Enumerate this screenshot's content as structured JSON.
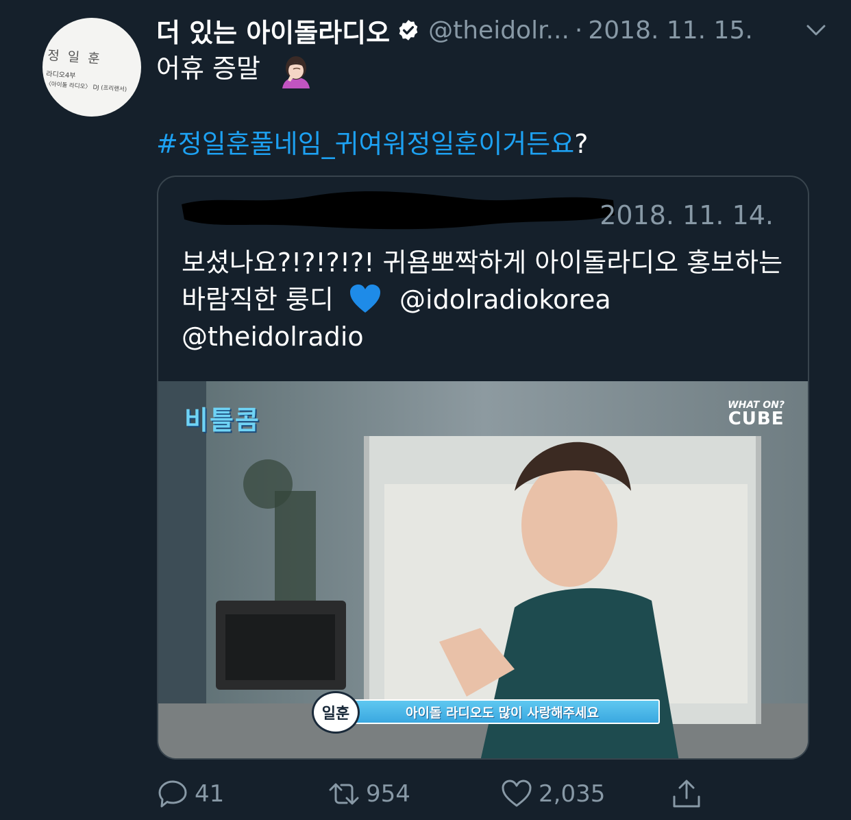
{
  "profile": {
    "avatar_name": "정 일 훈",
    "avatar_sub1": "라디오4부",
    "avatar_sub2": "〈아이돌 라디오〉 DJ (프리랜서)"
  },
  "tweet": {
    "display_name": "더 있는 아이돌라디오",
    "handle": "@theidolr...",
    "separator": "·",
    "timestamp": "2018. 11. 15.",
    "text_line1": "어휴 증말",
    "hashtag": "#정일훈풀네임_귀여워정일훈이거든요",
    "hashtag_suffix": "?"
  },
  "quoted_tweet": {
    "timestamp": "2018. 11. 14.",
    "text": "보셨나요?!?!?!?! 귀욤뽀짝하게 아이돌라디오 홍보하는 바람직한 룽디",
    "mention1": "@idolradiokorea",
    "mention2": "@theidolradio",
    "media": {
      "logo_left": "비틀콤",
      "logo_right_line1": "WHAT ON?",
      "logo_right_line2": "CUBE",
      "caption_speaker": "일훈",
      "caption_text": "아이돌 라디오도 많이 사랑해주세요"
    }
  },
  "actions": {
    "reply_count": "41",
    "retweet_count": "954",
    "like_count": "2,035"
  },
  "colors": {
    "background": "#15202b",
    "text_secondary": "#8899a6",
    "accent": "#1da1f2",
    "border": "#38444d"
  },
  "icons": [
    "verified-badge-icon",
    "chevron-down-icon",
    "reply-icon",
    "retweet-icon",
    "like-icon",
    "share-icon"
  ]
}
